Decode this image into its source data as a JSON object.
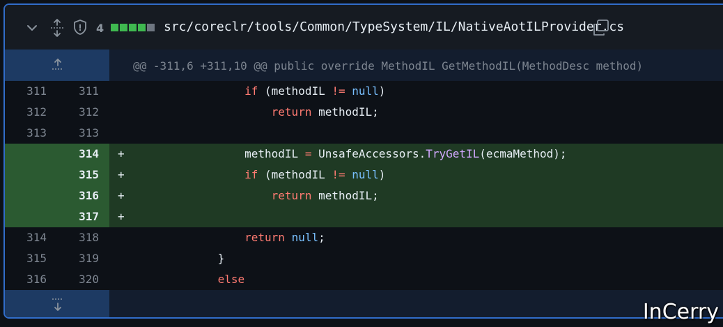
{
  "file_header": {
    "changes_count": "4",
    "diffstat_colors": [
      "#3fb950",
      "#3fb950",
      "#3fb950",
      "#3fb950",
      "#6e7681"
    ],
    "file_path": "src/coreclr/tools/Common/TypeSystem/IL/NativeAotILProvider.cs",
    "icons": [
      "chevron-down-icon",
      "expand-all-icon",
      "shield-icon",
      "copy-icon"
    ]
  },
  "hunk_header": "@@ -311,6 +311,10 @@ public override MethodIL GetMethodIL(MethodDesc method)",
  "lines": [
    {
      "type": "context",
      "old": "311",
      "new": "311",
      "sign": "",
      "indent": "                    ",
      "tokens": [
        {
          "t": "if",
          "c": "kw"
        },
        {
          "t": " (methodIL ",
          "c": ""
        },
        {
          "t": "!=",
          "c": "kw"
        },
        {
          "t": " ",
          "c": ""
        },
        {
          "t": "null",
          "c": "lit"
        },
        {
          "t": ")",
          "c": ""
        }
      ]
    },
    {
      "type": "context",
      "old": "312",
      "new": "312",
      "sign": "",
      "indent": "                        ",
      "tokens": [
        {
          "t": "return",
          "c": "kw"
        },
        {
          "t": " methodIL;",
          "c": ""
        }
      ]
    },
    {
      "type": "context",
      "old": "313",
      "new": "313",
      "sign": "",
      "indent": "",
      "tokens": []
    },
    {
      "type": "add",
      "old": "",
      "new": "314",
      "sign": "+",
      "indent": "                    ",
      "tokens": [
        {
          "t": "methodIL ",
          "c": ""
        },
        {
          "t": "=",
          "c": "kw"
        },
        {
          "t": " UnsafeAccessors.",
          "c": ""
        },
        {
          "t": "TryGetIL",
          "c": "fn"
        },
        {
          "t": "(ecmaMethod);",
          "c": ""
        }
      ]
    },
    {
      "type": "add",
      "old": "",
      "new": "315",
      "sign": "+",
      "indent": "                    ",
      "tokens": [
        {
          "t": "if",
          "c": "kw"
        },
        {
          "t": " (methodIL ",
          "c": ""
        },
        {
          "t": "!=",
          "c": "kw"
        },
        {
          "t": " ",
          "c": ""
        },
        {
          "t": "null",
          "c": "lit"
        },
        {
          "t": ")",
          "c": ""
        }
      ]
    },
    {
      "type": "add",
      "old": "",
      "new": "316",
      "sign": "+",
      "indent": "                        ",
      "tokens": [
        {
          "t": "return",
          "c": "kw"
        },
        {
          "t": " methodIL;",
          "c": ""
        }
      ]
    },
    {
      "type": "add",
      "old": "",
      "new": "317",
      "sign": "+",
      "indent": "",
      "tokens": []
    },
    {
      "type": "context",
      "old": "314",
      "new": "318",
      "sign": "",
      "indent": "                    ",
      "tokens": [
        {
          "t": "return",
          "c": "kw"
        },
        {
          "t": " ",
          "c": ""
        },
        {
          "t": "null",
          "c": "lit"
        },
        {
          "t": ";",
          "c": ""
        }
      ]
    },
    {
      "type": "context",
      "old": "315",
      "new": "319",
      "sign": "",
      "indent": "                ",
      "tokens": [
        {
          "t": "}",
          "c": ""
        }
      ]
    },
    {
      "type": "context",
      "old": "316",
      "new": "320",
      "sign": "",
      "indent": "                ",
      "tokens": [
        {
          "t": "else",
          "c": "kw"
        }
      ]
    }
  ],
  "watermark": "InCerry"
}
